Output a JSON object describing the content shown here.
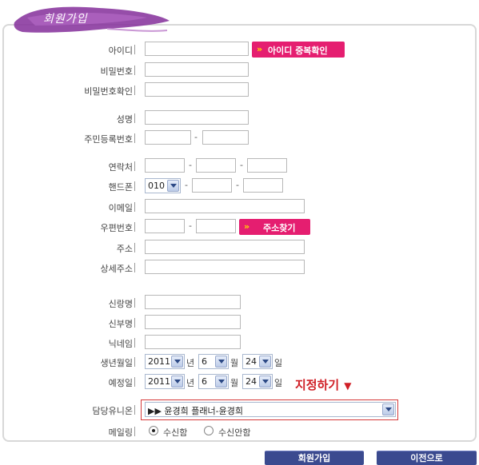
{
  "header": {
    "title": "회원가입"
  },
  "form": {
    "id_label": "아이디",
    "id_check_button": "아이디 중복확인",
    "password_label": "비밀번호",
    "password_confirm_label": "비밀번호확인",
    "name_label": "성명",
    "resident_number_label": "주민등록번호",
    "phone_label": "연락처",
    "mobile_label": "핸드폰",
    "mobile_prefix": "010",
    "email_label": "이메일",
    "postal_code_label": "우편번호",
    "address_search_button": "주소찾기",
    "address_label": "주소",
    "address_detail_label": "상세주소",
    "groom_label": "신랑명",
    "bride_label": "신부명",
    "nickname_label": "닉네임",
    "birth_label": "생년월일",
    "birth_year": "2011",
    "birth_month": "6",
    "birth_day": "24",
    "wedding_label": "예정일",
    "wedding_year": "2011",
    "wedding_month": "6",
    "wedding_day": "24",
    "unit_year": "년",
    "unit_month": "월",
    "unit_day": "일",
    "designate_text": "지정하기",
    "union_label": "담당유니온",
    "union_selected": "▶▶ 윤경희 플래너-윤경희",
    "mailing_label": "메일링",
    "mailing_options": [
      "수신함",
      "수신안함"
    ],
    "dash": "-"
  },
  "buttons": {
    "join": "회원가입",
    "back": "이전으로"
  },
  "colors": {
    "accent_pink": "#e51e70",
    "brand_purple": "#8b3aa0",
    "button_navy": "#3b4a8f",
    "designate_red": "#d01f26"
  },
  "icons": {
    "dropdown": "chevron-down-icon",
    "arrow": "double-chevron-icon"
  }
}
